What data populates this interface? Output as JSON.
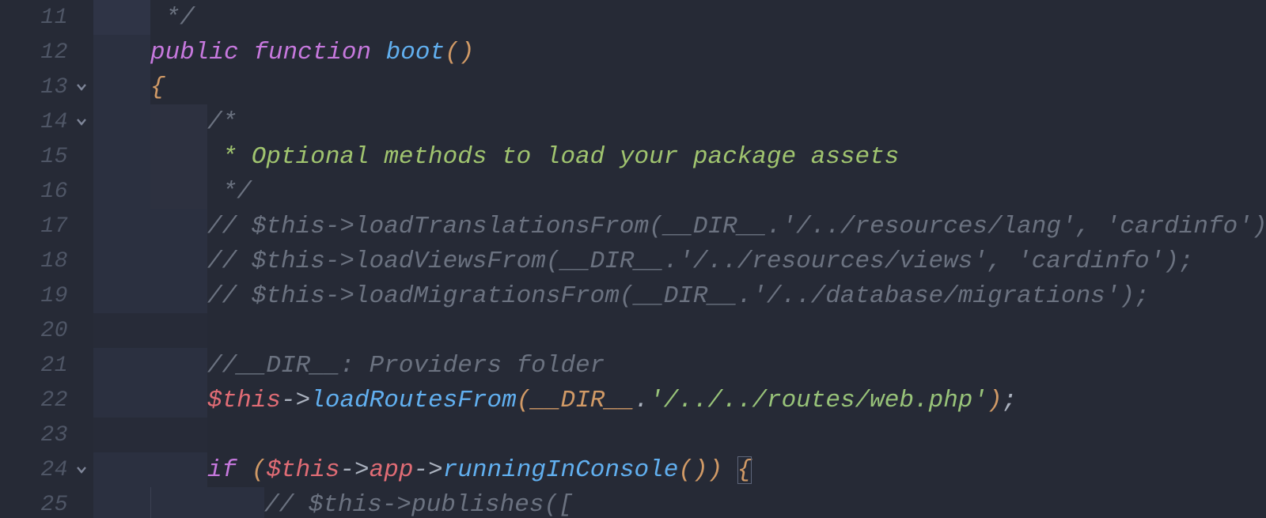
{
  "gutter": {
    "lines": [
      "11",
      "12",
      "13",
      "14",
      "15",
      "16",
      "17",
      "18",
      "19",
      "20",
      "21",
      "22",
      "23",
      "24",
      "25"
    ],
    "fold_at": [
      "13",
      "14",
      "24"
    ]
  },
  "tokens": {
    "l11_comment": " */",
    "l12_public": "public",
    "l12_function": "function",
    "l12_boot": "boot",
    "l12_paren": "()",
    "l13_brace": "{",
    "l14_open": "/*",
    "l15_doc": " * Optional methods to load your package assets",
    "l16_close": " */",
    "l17_comment": "// $this->loadTranslationsFrom(__DIR__.'/../resources/lang', 'cardinfo');",
    "l18_comment": "// $this->loadViewsFrom(__DIR__.'/../resources/views', 'cardinfo');",
    "l19_comment": "// $this->loadMigrationsFrom(__DIR__.'/../database/migrations');",
    "l21_comment": "//__DIR__: Providers folder",
    "l22_this": "$this",
    "l22_arrow": "->",
    "l22_method": "loadRoutesFrom",
    "l22_lp": "(",
    "l22_dir": "__DIR__",
    "l22_dot": ".",
    "l22_str": "'/../../routes/web.php'",
    "l22_rp": ")",
    "l22_semi": ";",
    "l24_if": "if",
    "l24_lp": "(",
    "l24_this": "$this",
    "l24_arrow1": "->",
    "l24_app": "app",
    "l24_arrow2": "->",
    "l24_method": "runningInConsole",
    "l24_call": "()",
    "l24_rp": ")",
    "l24_brace": "{",
    "l25_comment": "// $this->publishes(["
  }
}
